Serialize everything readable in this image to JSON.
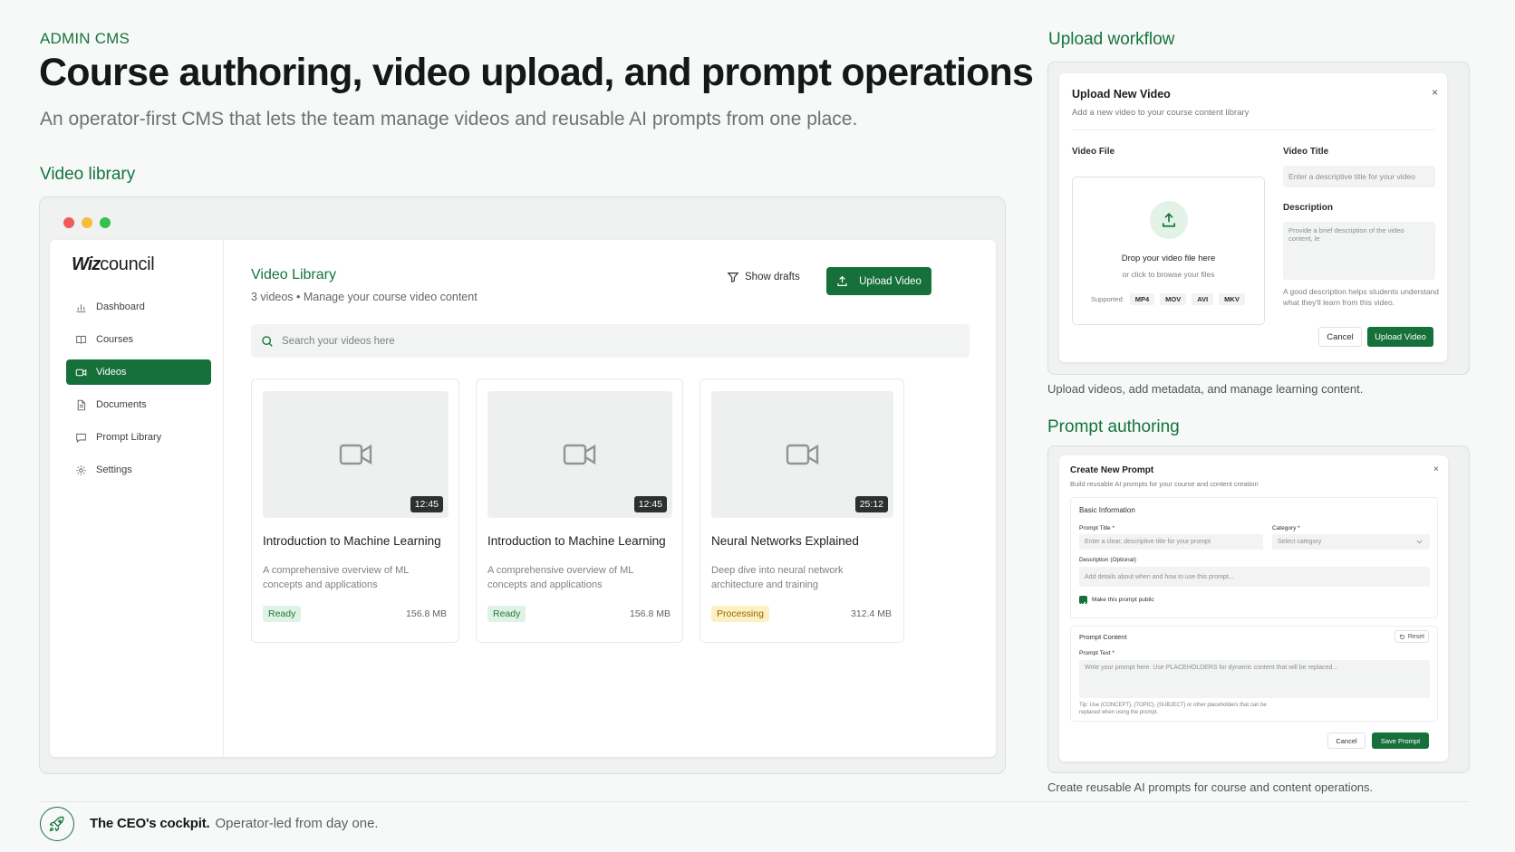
{
  "header": {
    "eyebrow": "ADMIN CMS",
    "headline": "Course authoring, video upload, and prompt operations",
    "subhead": "An operator-first CMS that lets the team manage videos and reusable AI prompts from one place."
  },
  "sections": {
    "video_library": "Video library",
    "upload_workflow": "Upload workflow",
    "prompt_authoring": "Prompt authoring"
  },
  "colors": {
    "accent": "#16703a",
    "accent_text": "#15753d",
    "ready_bg": "#def3e3",
    "processing_bg": "#fdf1c2"
  },
  "app": {
    "logo_bold": "Wiz",
    "logo_rest": "council",
    "nav": [
      {
        "label": "Dashboard",
        "icon": "bar-chart-icon"
      },
      {
        "label": "Courses",
        "icon": "book-icon"
      },
      {
        "label": "Videos",
        "icon": "video-icon",
        "active": true
      },
      {
        "label": "Documents",
        "icon": "document-icon"
      },
      {
        "label": "Prompt Library",
        "icon": "message-icon"
      },
      {
        "label": "Settings",
        "icon": "gear-icon"
      }
    ],
    "library": {
      "title": "Video Library",
      "subtitle": "3 videos • Manage your course video content",
      "show_drafts": "Show drafts",
      "upload_button": "Upload Video",
      "search_placeholder": "Search your videos here"
    },
    "videos": [
      {
        "title": "Introduction to Machine Learning",
        "description": "A comprehensive overview of ML concepts and applications",
        "duration": "12:45",
        "status": "Ready",
        "size": "156.8 MB"
      },
      {
        "title": "Introduction to Machine Learning",
        "description": "A comprehensive overview of ML concepts and applications",
        "duration": "12:45",
        "status": "Ready",
        "size": "156.8 MB"
      },
      {
        "title": "Neural Networks Explained",
        "description": "Deep dive into neural network architecture and training",
        "duration": "25:12",
        "status": "Processing",
        "size": "312.4 MB"
      }
    ]
  },
  "upload_modal": {
    "title": "Upload New Video",
    "subtitle": "Add a new video to your course content library",
    "close": "×",
    "file_label": "Video File",
    "drop_title": "Drop your video file here",
    "drop_sub": "or click to browse your files",
    "supported_label": "Supported:",
    "formats": [
      "MP4",
      "MOV",
      "AVI",
      "MKV"
    ],
    "title_label": "Video Title",
    "title_placeholder": "Enter a descriptive title for your video",
    "description_label": "Description",
    "description_placeholder": "Provide a brief description of the video content, le",
    "description_hint": "A good description helps students understand what they'll learn from this video.",
    "cancel": "Cancel",
    "submit": "Upload Video",
    "caption": "Upload videos, add metadata, and manage learning content."
  },
  "prompt_modal": {
    "title": "Create New Prompt",
    "subtitle": "Build reusable AI prompts for your course and content creation",
    "close": "×",
    "basic_info": "Basic Information",
    "prompt_title_label": "Prompt Title *",
    "prompt_title_placeholder": "Enter a clear, descriptive title for your prompt",
    "category_label": "Category *",
    "category_placeholder": "Select category",
    "description_label": "Description (Optional)",
    "description_placeholder": "Add details about when and how to use this prompt...",
    "public_label": "Make this prompt public",
    "content_label": "Prompt Content",
    "reset": "Reset",
    "prompt_text_label": "Prompt Text *",
    "prompt_text_placeholder": "Write your prompt here. Use PLACEHOLDERS for dynamic content that will be replaced...",
    "tip": "Tip: Use {CONCEPT}, {TOPIC}, {SUBJECT} or other placeholders that can be replaced when using the prompt.",
    "cancel": "Cancel",
    "submit": "Save Prompt",
    "caption": "Create reusable AI prompts for course and content operations."
  },
  "footer": {
    "strong": "The CEO's cockpit.",
    "rest": "Operator-led from day one.",
    "icon": "rocket-icon"
  }
}
